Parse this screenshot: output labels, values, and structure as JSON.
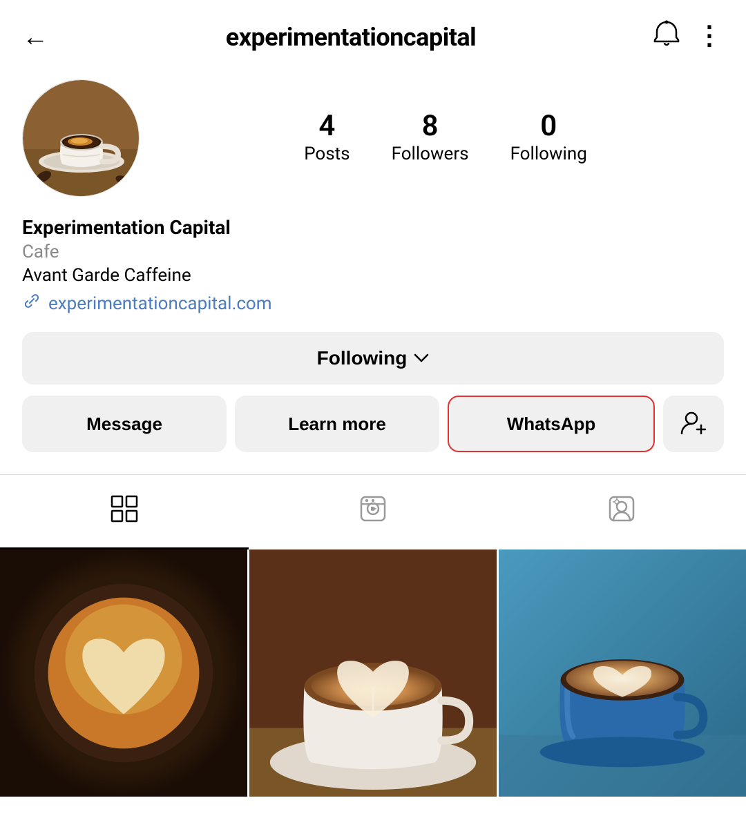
{
  "header": {
    "username": "experimentationcapital",
    "back_label": "←",
    "notification_icon": "bell-icon",
    "more_icon": "more-icon"
  },
  "profile": {
    "avatar_alt": "Coffee cup profile photo",
    "stats": {
      "posts": {
        "count": "4",
        "label": "Posts"
      },
      "followers": {
        "count": "8",
        "label": "Followers"
      },
      "following": {
        "count": "0",
        "label": "Following"
      }
    },
    "name": "Experimentation Capital",
    "category": "Cafe",
    "tagline": "Avant Garde Caffeine",
    "website": "experimentationcapital.com",
    "website_href": "experimentationcapital.com"
  },
  "buttons": {
    "following_label": "Following",
    "message_label": "Message",
    "learn_more_label": "Learn more",
    "whatsapp_label": "WhatsApp",
    "add_friend_icon": "+👤"
  },
  "tabs": [
    {
      "id": "grid",
      "label": "Grid",
      "icon": "grid-icon",
      "active": true
    },
    {
      "id": "reels",
      "label": "Reels",
      "icon": "reels-icon",
      "active": false
    },
    {
      "id": "tagged",
      "label": "Tagged",
      "icon": "tagged-icon",
      "active": false
    }
  ],
  "grid": {
    "cell1_alt": "Coffee latte art dark",
    "cell2_alt": "Coffee latte heart art",
    "cell3_alt": "Blue cup coffee"
  }
}
